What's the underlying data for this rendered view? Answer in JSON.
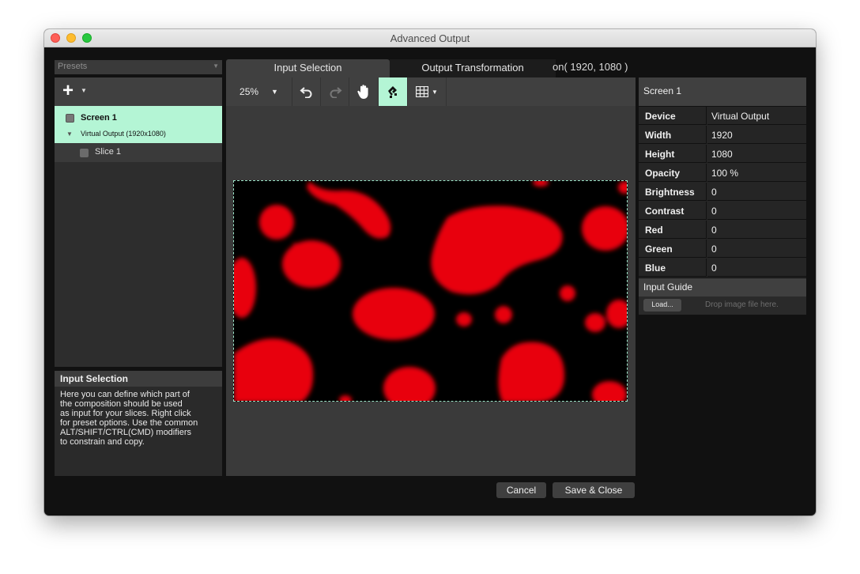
{
  "window": {
    "title": "Advanced Output"
  },
  "presets": {
    "placeholder": "Presets"
  },
  "tree": {
    "screen_name": "Screen 1",
    "screen_device": "Virtual Output (1920x1080)",
    "slice_name": "Slice 1"
  },
  "info": {
    "title": "Input Selection",
    "lines": [
      "Here you can define which part of",
      "the composition should be used",
      "as input for your slices. Right click",
      "for preset options. Use the common",
      "ALT/SHIFT/CTRL(CMD) modifiers",
      "to constrain and copy."
    ]
  },
  "tabs": {
    "input_selection": "Input Selection",
    "output_transformation": "Output Transformation",
    "clipped_text": "on( 1920, 1080 )"
  },
  "toolbar": {
    "zoom": "25%"
  },
  "properties": {
    "title": "Screen 1",
    "device_label": "Device",
    "device_value": "Virtual Output",
    "width_label": "Width",
    "width_value": "1920",
    "height_label": "Height",
    "height_value": "1080",
    "opacity_label": "Opacity",
    "opacity_value": "100 %",
    "brightness_label": "Brightness",
    "brightness_value": "0",
    "contrast_label": "Contrast",
    "contrast_value": "0",
    "red_label": "Red",
    "red_value": "0",
    "green_label": "Green",
    "green_value": "0",
    "blue_label": "Blue",
    "blue_value": "0",
    "minus": "–",
    "plus": "+"
  },
  "input_guide": {
    "title": "Input Guide",
    "load_label": "Load...",
    "drop_hint": "Drop image file here."
  },
  "footer": {
    "cancel_label": "Cancel",
    "save_label": "Save & Close"
  },
  "colors": {
    "accent": "#b4f5d5",
    "blob": "#e8000f",
    "background": "#111111"
  }
}
